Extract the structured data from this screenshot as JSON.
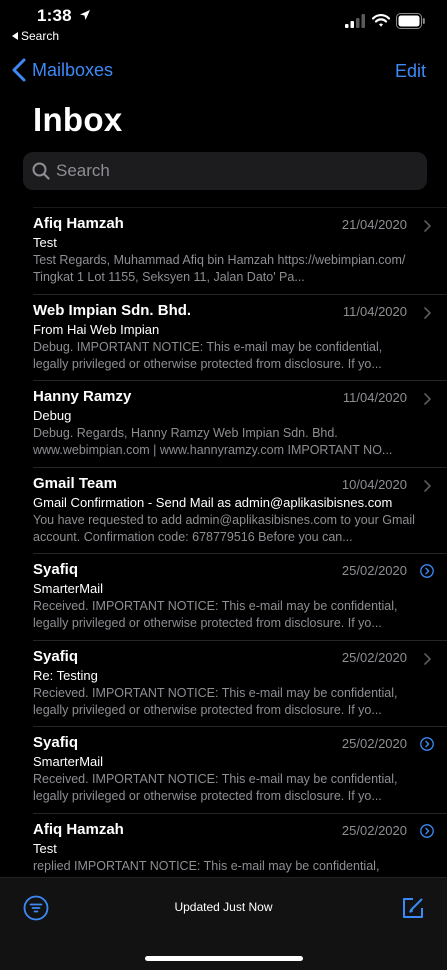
{
  "status_bar": {
    "time": "1:38",
    "back_app": "Search"
  },
  "nav": {
    "back_label": "Mailboxes",
    "edit_label": "Edit",
    "title": "Inbox"
  },
  "search": {
    "placeholder": "Search",
    "value": ""
  },
  "mails": [
    {
      "sender": "Afiq Hamzah",
      "date": "21/04/2020",
      "subject": "Test",
      "preview": "Test Regards, Muhammad Afiq bin Hamzah https://webimpian.com/ Tingkat 1 Lot 1155, Seksyen 11, Jalan Dato' Pa...",
      "indicator": "chevron"
    },
    {
      "sender": "Web Impian Sdn. Bhd.",
      "date": "11/04/2020",
      "subject": "From Hai Web Impian",
      "preview": "Debug. IMPORTANT NOTICE: This e-mail may be confidential, legally privileged or otherwise protected from disclosure. If yo...",
      "indicator": "chevron"
    },
    {
      "sender": "Hanny Ramzy",
      "date": "11/04/2020",
      "subject": "Debug",
      "preview": "Debug. Regards, Hanny Ramzy Web Impian Sdn. Bhd. www.webimpian.com | www.hannyramzy.com IMPORTANT NO...",
      "indicator": "chevron"
    },
    {
      "sender": "Gmail Team",
      "date": "10/04/2020",
      "subject": "Gmail Confirmation - Send Mail as admin@aplikasibisnes.com",
      "preview": "You have requested to add admin@aplikasibisnes.com to your Gmail account. Confirmation code: 678779516 Before you can...",
      "indicator": "chevron"
    },
    {
      "sender": "Syafiq",
      "date": "25/02/2020",
      "subject": "SmarterMail",
      "preview": "Received. IMPORTANT NOTICE: This e-mail may be confidential, legally privileged or otherwise protected from disclosure. If yo...",
      "indicator": "thread"
    },
    {
      "sender": "Syafiq",
      "date": "25/02/2020",
      "subject": "Re: Testing",
      "preview": "Recieved. IMPORTANT NOTICE: This e-mail may be confidential, legally privileged or otherwise protected from disclosure. If yo...",
      "indicator": "chevron"
    },
    {
      "sender": "Syafiq",
      "date": "25/02/2020",
      "subject": "SmarterMail",
      "preview": "Received. IMPORTANT NOTICE: This e-mail may be confidential, legally privileged or otherwise protected from disclosure. If yo...",
      "indicator": "thread"
    },
    {
      "sender": "Afiq Hamzah",
      "date": "25/02/2020",
      "subject": "Test",
      "preview": "replied IMPORTANT NOTICE: This e-mail may be confidential, legally privileged or otherwise protected from disclosure. If yo...",
      "indicator": "thread"
    }
  ],
  "toolbar": {
    "status": "Updated Just Now"
  },
  "colors": {
    "background": "#000000",
    "accent": "#3d8af7",
    "secondary_text": "#8e8e93",
    "search_bg": "#1c1c1e"
  }
}
